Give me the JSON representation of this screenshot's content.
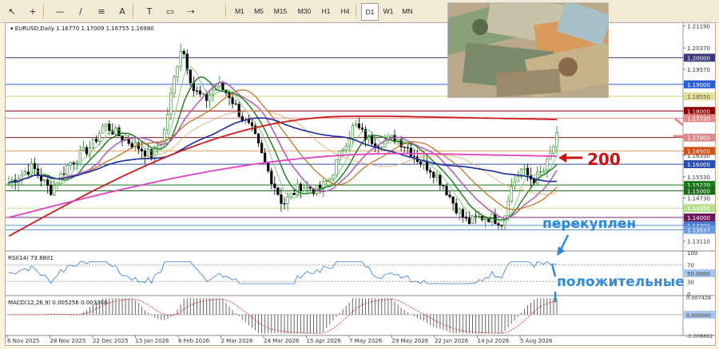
{
  "toolbar": {
    "timeframes": [
      "M1",
      "M5",
      "M15",
      "M30",
      "H1",
      "H4",
      "D1",
      "W1",
      "MN"
    ],
    "active": "D1",
    "tool_icons": [
      "cursor-icon",
      "crosshair-icon",
      "hline-icon",
      "trendline-icon",
      "fib-icon",
      "text-icon",
      "label-icon",
      "rect-icon",
      "arrow-icon"
    ]
  },
  "header": {
    "symbol": "EURUSD,Daily",
    "ohlc": "1.16770 1.17009 1.16755 1.16980"
  },
  "price_axis": {
    "labels": [
      "1.21190",
      "1.20370",
      "1.20000",
      "1.19570",
      "1.19000",
      "1.18550",
      "1.18000",
      "1.17730",
      "1.17000",
      "1.16500",
      "1.16330",
      "1.16000",
      "1.15530",
      "1.15220",
      "1.15000",
      "1.14730",
      "1.14350",
      "1.14000",
      "1.13700",
      "1.13537",
      "1.13110"
    ],
    "ymin": 1.128,
    "ymax": 1.213
  },
  "levels": [
    {
      "price": 1.2,
      "color": "#3a3a7a",
      "label": "1.20000",
      "bg": "#3a3a7a",
      "fg": "#ffffff"
    },
    {
      "price": 1.19,
      "color": "#2a5fd6",
      "label": "1.19000",
      "bg": "#2a5fd6",
      "fg": "#ffffff"
    },
    {
      "price": 1.1855,
      "color": "#cfcf7a",
      "label": "1.18550",
      "bg": "#e6e09b",
      "fg": "#555555"
    },
    {
      "price": 1.18,
      "color": "#8b0000",
      "label": "1.18000",
      "bg": "#8b0000",
      "fg": "#ffffff"
    },
    {
      "price": 1.1773,
      "color": "#e58a8a",
      "label": "1.17730",
      "bg": "#e58a8a",
      "fg": "#ffffff"
    },
    {
      "price": 1.17,
      "color": "#7a1e1e",
      "label": "1.17000",
      "bg": "#d98c8c",
      "fg": "#ffffff"
    },
    {
      "price": 1.165,
      "color": "#e0a060",
      "label": "1.16500",
      "bg": "#d05018",
      "fg": "#ffffff"
    },
    {
      "price": 1.16,
      "color": "#2a4fb0",
      "label": "1.16000",
      "bg": "#2a4fb0",
      "fg": "#ffffff"
    },
    {
      "price": 1.1522,
      "color": "#1a7a1a",
      "label": "1.15220",
      "bg": "#1a7a1a",
      "fg": "#ffffff"
    },
    {
      "price": 1.15,
      "color": "#1a6a1a",
      "label": "1.15000",
      "bg": "#1a6a1a",
      "fg": "#ffffff"
    },
    {
      "price": 1.1435,
      "color": "#c8e6a0",
      "label": "1.14350",
      "bg": "#b8e08a",
      "fg": "#ffffff"
    },
    {
      "price": 1.14,
      "color": "#6a2a6a",
      "label": "1.14000",
      "bg": "#6a1a5a",
      "fg": "#ffffff"
    },
    {
      "price": 1.137,
      "color": "#5a8ad0",
      "label": "1.13700",
      "bg": "#4a7ad0",
      "fg": "#ffffff"
    },
    {
      "price": 1.13537,
      "color": "#5a8ad0",
      "label": "1.13537",
      "bg": "#6a9ae0",
      "fg": "#ffffff"
    }
  ],
  "rsi": {
    "label": "RSI(14) 73.8801",
    "axis": [
      "100",
      "70",
      "50.0000",
      "30",
      "0"
    ],
    "highlight_value": "50.0000"
  },
  "macd": {
    "label": "MACD(12,26,9) 0.005256 0.003388",
    "axis": [
      "0.007428",
      "0.000000",
      "-0.008862"
    ]
  },
  "dates": [
    "6 Nov 2025",
    "28 Nov 2025",
    "22 Dec 2025",
    "15 Jan 2026",
    "6 Feb 2026",
    "2 Mar 2026",
    "24 Mar 2026",
    "15 Apr 2026",
    "7 May 2026",
    "29 May 2026",
    "22 Jun 2026",
    "14 Jul 2026",
    "5 Aug 2026"
  ],
  "annotations": {
    "ma200": "200",
    "overbought": "перекуплен",
    "positive": "положительные"
  },
  "colors": {
    "annotation_red": "#cc1111",
    "annotation_blue": "#2a8ad8",
    "bull": "#1a8a1a",
    "bear": "#000000"
  }
}
